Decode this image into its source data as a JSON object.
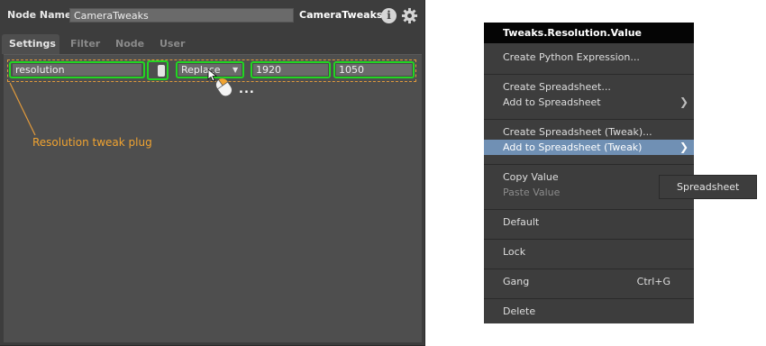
{
  "node_editor": {
    "node_name_label": "Node Name",
    "node_name_value": "CameraTweaks",
    "node_type": "CameraTweaks",
    "tabs": [
      {
        "label": "Settings",
        "active": true
      },
      {
        "label": "Filter",
        "active": false
      },
      {
        "label": "Node",
        "active": false
      },
      {
        "label": "User",
        "active": false
      }
    ],
    "plug": {
      "name": "resolution",
      "mode": "Replace",
      "value_x": "1920",
      "value_y": "1050"
    },
    "annotation": "Resolution tweak plug",
    "cursor_ellipsis": "...",
    "colors": {
      "highlight": "#22d622",
      "annotation": "#f0a331",
      "menu_hover": "#7090b4"
    }
  },
  "context_menu": {
    "title": "Tweaks.Resolution.Value",
    "items": [
      {
        "label": "Create Python Expression..."
      },
      {
        "label": "Create Spreadsheet..."
      },
      {
        "label": "Add to Spreadsheet",
        "submenu": true
      },
      {
        "label": "Create Spreadsheet (Tweak)..."
      },
      {
        "label": "Add to Spreadsheet (Tweak)",
        "submenu": true,
        "highlighted": true
      },
      {
        "label": "Copy Value"
      },
      {
        "label": "Paste Value",
        "disabled": true
      },
      {
        "label": "Default"
      },
      {
        "label": "Lock"
      },
      {
        "label": "Gang",
        "shortcut": "Ctrl+G"
      },
      {
        "label": "Delete"
      }
    ],
    "chevron": "❯"
  },
  "submenu": {
    "items": [
      {
        "label": "Spreadsheet"
      }
    ]
  }
}
